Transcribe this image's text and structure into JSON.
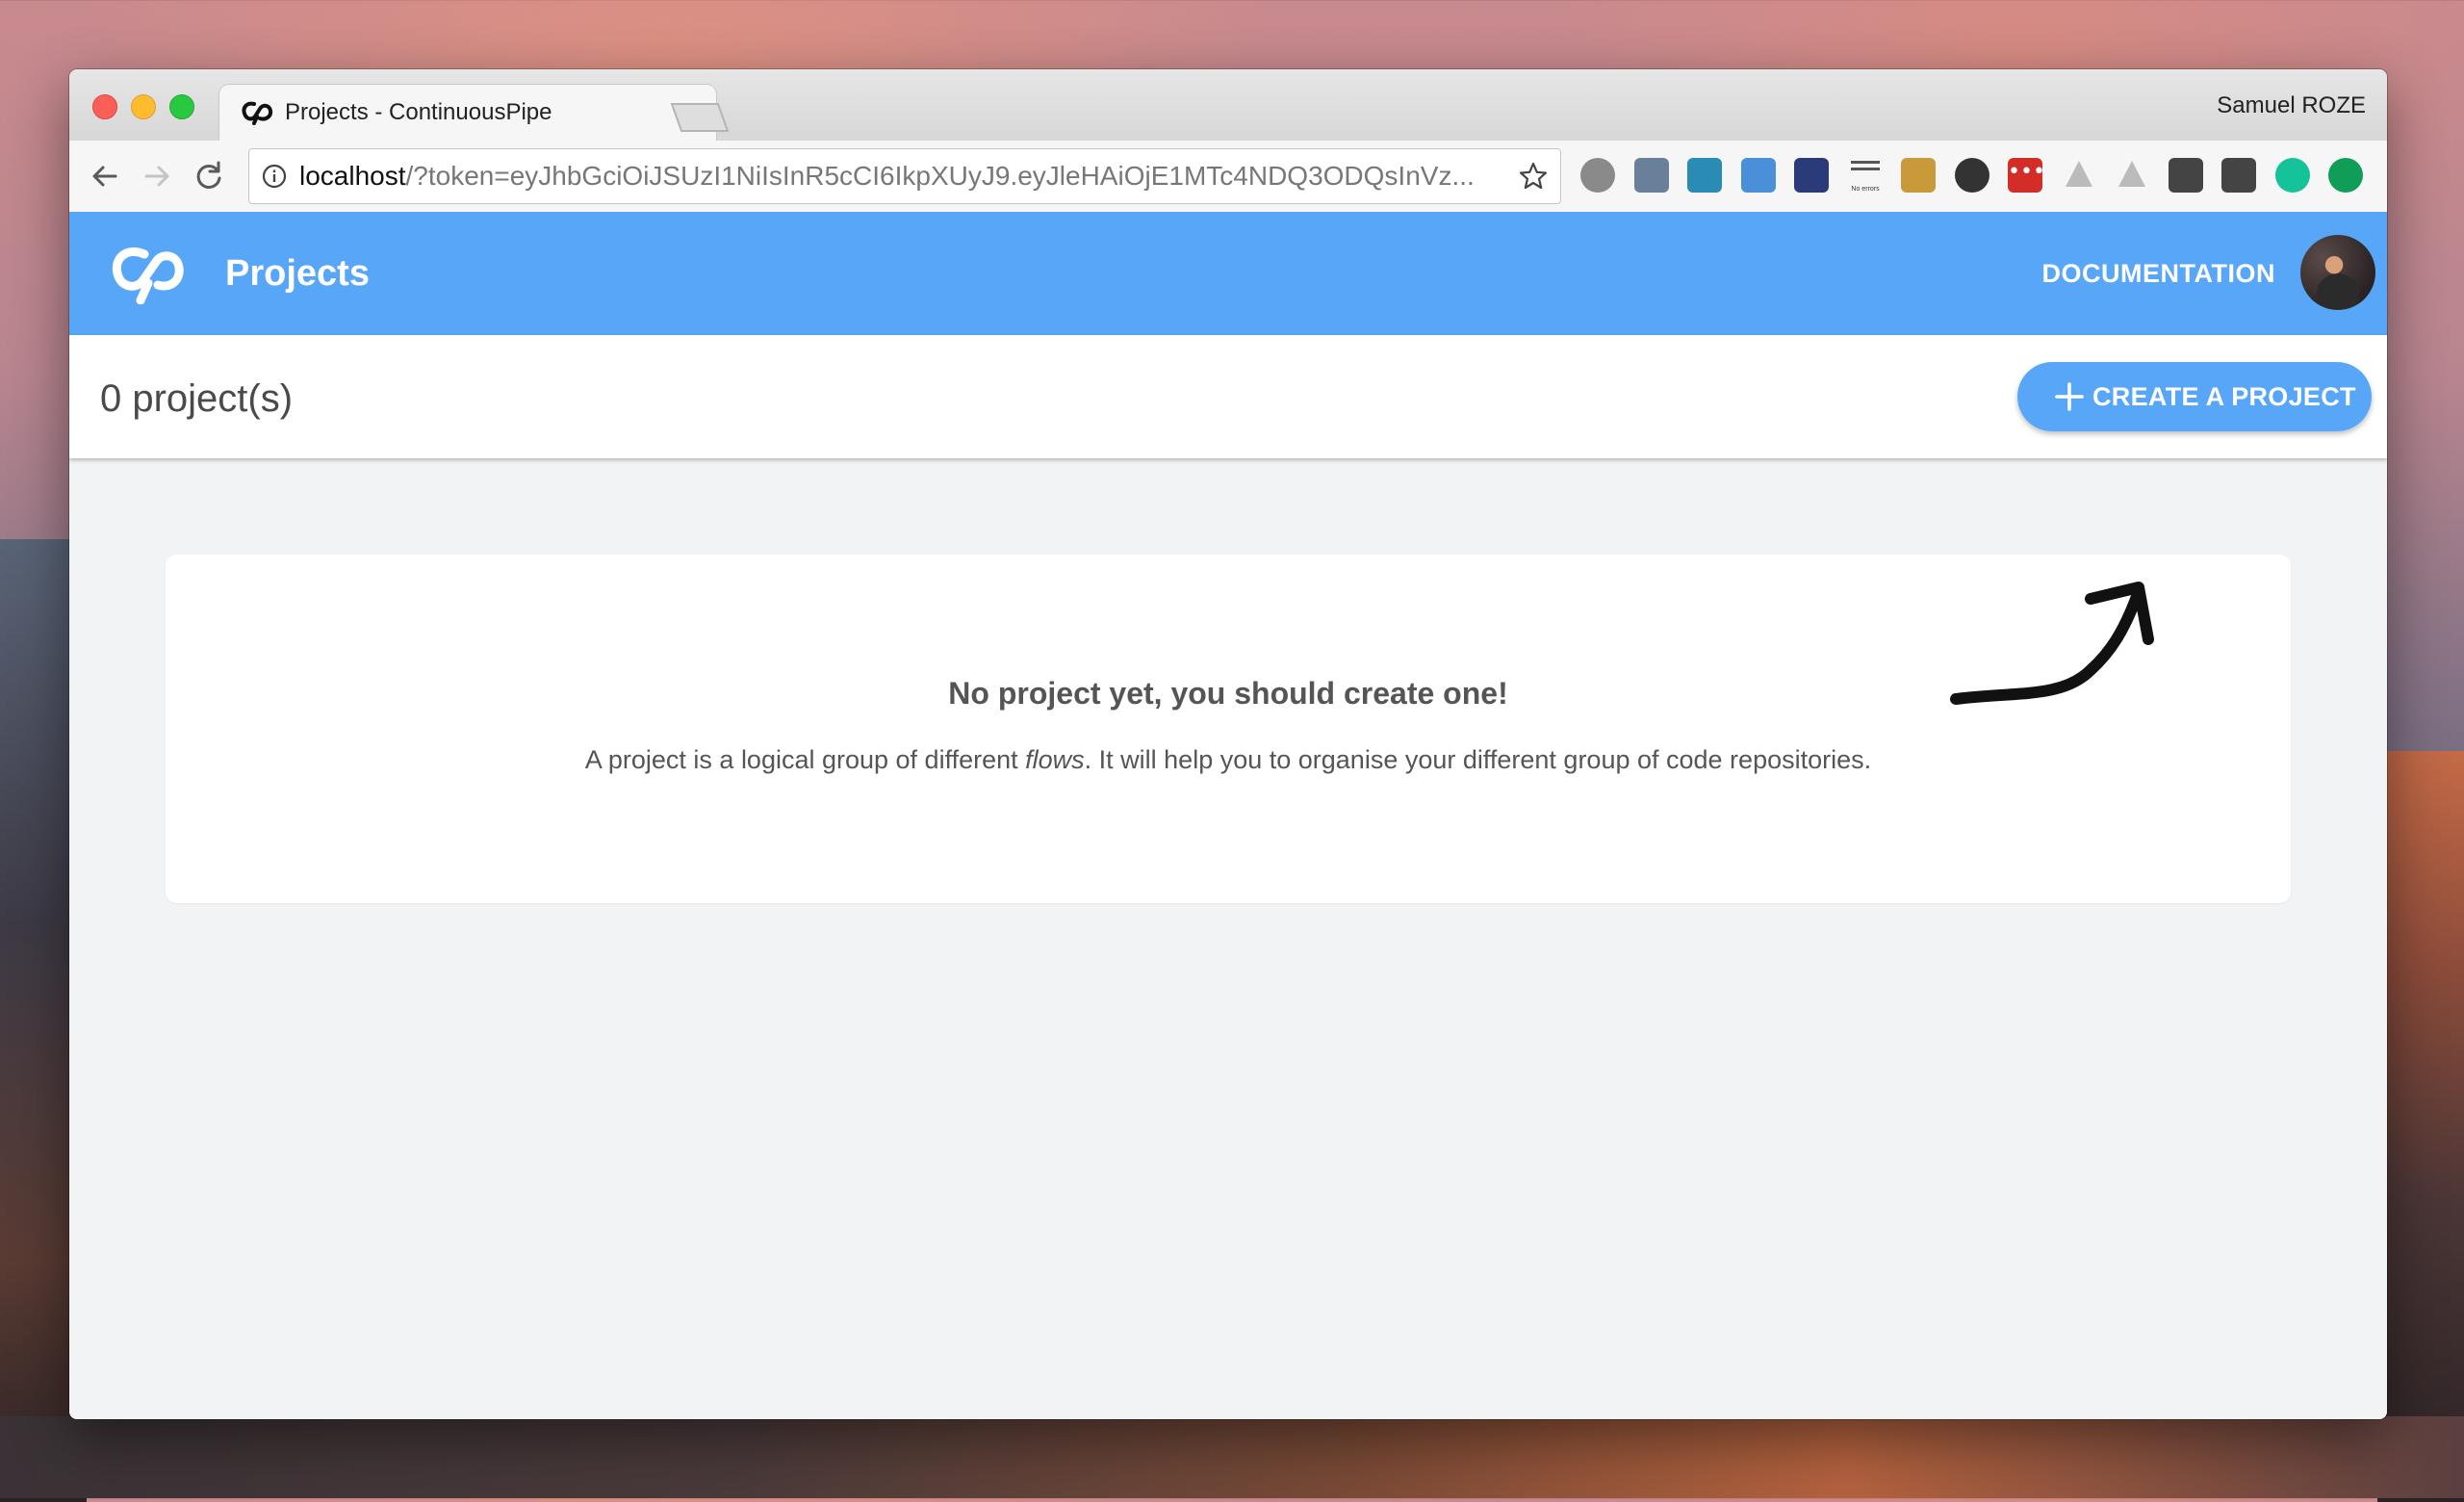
{
  "browser": {
    "tab_title": "Projects - ContinuousPipe",
    "tab_close": "×",
    "profile_name": "Samuel ROZE",
    "url_host": "localhost",
    "url_rest": "/?token=eyJhbGciOiJSUzI1NiIsInR5cCI6IkpXUyJ9.eyJleHAiOjE1MTc4NDQ3ODQsInVz...",
    "extensions": [
      {
        "name": "settings-extension-icon",
        "color": "#8a8a8a"
      },
      {
        "name": "dropper-extension-icon",
        "color": "#6a7f9a"
      },
      {
        "name": "wave-extension-icon",
        "color": "#2a8bb5"
      },
      {
        "name": "folder-extension-icon",
        "color": "#4a90d9"
      },
      {
        "name": "night-extension-icon",
        "color": "#2b3b7a"
      },
      {
        "name": "no-errors-extension-icon",
        "color": "#555555"
      },
      {
        "name": "pointer-extension-icon",
        "color": "#c89a3a"
      },
      {
        "name": "flame-extension-icon",
        "color": "#333333"
      },
      {
        "name": "lastpass-extension-icon",
        "color": "#d32d27"
      },
      {
        "name": "angular-extension-icon",
        "color": "#bbbbbb"
      },
      {
        "name": "drive-extension-icon",
        "color": "#bbbbbb"
      },
      {
        "name": "mail-extension-icon",
        "color": "#444444"
      },
      {
        "name": "bulb-extension-icon",
        "color": "#444444"
      },
      {
        "name": "grammarly-extension-icon",
        "color": "#15c39a"
      },
      {
        "name": "upload-extension-icon",
        "color": "#0f9d58"
      }
    ],
    "no_errors_label": "No errors"
  },
  "app": {
    "title": "Projects",
    "documentation_link": "DOCUMENTATION",
    "brand_color": "#58a6f8"
  },
  "projects": {
    "count_label": "0 project(s)",
    "create_button": "CREATE A PROJECT"
  },
  "empty_state": {
    "title": "No project yet, you should create one!",
    "desc_before": "A project is a logical group of different ",
    "desc_em": "flows",
    "desc_after": ". It will help you to organise your different group of code repositories."
  }
}
